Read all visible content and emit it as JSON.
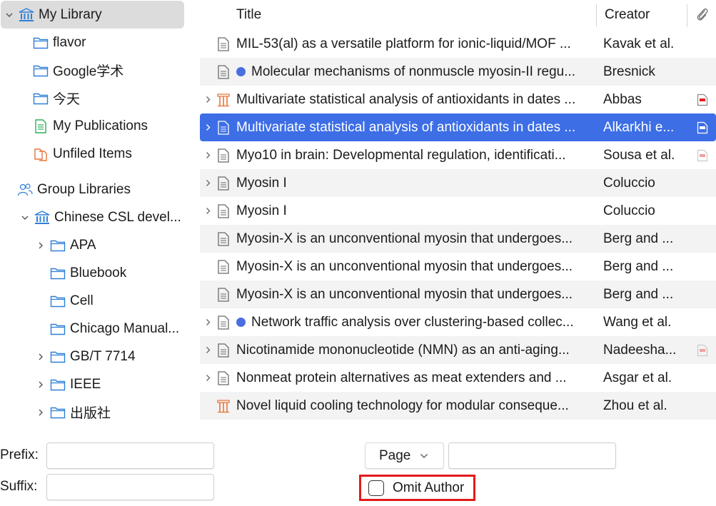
{
  "tree": {
    "my_library": "My Library",
    "collections": [
      {
        "label": "flavor",
        "icon": "folder-icon"
      },
      {
        "label": "Google学术",
        "icon": "folder-icon"
      },
      {
        "label": "今天",
        "icon": "folder-icon"
      },
      {
        "label": "My Publications",
        "icon": "publications-icon"
      },
      {
        "label": "Unfiled Items",
        "icon": "unfiled-icon"
      }
    ],
    "group_libraries": "Group Libraries",
    "group": {
      "label": "Chinese CSL devel...",
      "children": [
        {
          "label": "APA",
          "expandable": true
        },
        {
          "label": "Bluebook",
          "expandable": false
        },
        {
          "label": "Cell",
          "expandable": false
        },
        {
          "label": "Chicago Manual...",
          "expandable": false
        },
        {
          "label": "GB/T 7714",
          "expandable": true
        },
        {
          "label": "IEEE",
          "expandable": true
        },
        {
          "label": "出版社",
          "expandable": true
        }
      ]
    }
  },
  "table": {
    "columns": {
      "title": "Title",
      "creator": "Creator"
    },
    "rows": [
      {
        "title": "MIL-53(al) as a versatile platform for ionic-liquid/MOF ...",
        "creator": "Kavak et al.",
        "type": "document",
        "twisty": false,
        "dot": false,
        "attachment": ""
      },
      {
        "title": "Molecular mechanisms of nonmuscle myosin-II regu...",
        "creator": "Bresnick",
        "type": "document",
        "twisty": false,
        "dot": true,
        "attachment": ""
      },
      {
        "title": "Multivariate statistical analysis of antioxidants in dates ...",
        "creator": "Abbas",
        "type": "book",
        "twisty": true,
        "dot": false,
        "attachment": "pdf"
      },
      {
        "title": "Multivariate statistical analysis of antioxidants in dates ...",
        "creator": "Alkarkhi e...",
        "type": "document",
        "twisty": true,
        "dot": false,
        "attachment": "pdf",
        "selected": true
      },
      {
        "title": "Myo10 in brain: Developmental regulation, identificati...",
        "creator": "Sousa et al.",
        "type": "document",
        "twisty": true,
        "dot": false,
        "attachment": "pdf-faded"
      },
      {
        "title": "Myosin I",
        "creator": "Coluccio",
        "type": "document",
        "twisty": true,
        "dot": false,
        "attachment": ""
      },
      {
        "title": "Myosin I",
        "creator": "Coluccio",
        "type": "document",
        "twisty": true,
        "dot": false,
        "attachment": ""
      },
      {
        "title": "Myosin-X is an unconventional myosin that undergoes...",
        "creator": "Berg and ...",
        "type": "document",
        "twisty": false,
        "dot": false,
        "attachment": ""
      },
      {
        "title": "Myosin-X is an unconventional myosin that undergoes...",
        "creator": "Berg and ...",
        "type": "document",
        "twisty": false,
        "dot": false,
        "attachment": ""
      },
      {
        "title": "Myosin-X is an unconventional myosin that undergoes...",
        "creator": "Berg and ...",
        "type": "document",
        "twisty": false,
        "dot": false,
        "attachment": ""
      },
      {
        "title": "Network traffic analysis over clustering-based collec...",
        "creator": "Wang et al.",
        "type": "document",
        "twisty": true,
        "dot": true,
        "attachment": ""
      },
      {
        "title": "Nicotinamide mononucleotide (NMN) as an anti-aging...",
        "creator": "Nadeesha...",
        "type": "document",
        "twisty": true,
        "dot": false,
        "attachment": "pdf-faded"
      },
      {
        "title": "Nonmeat protein alternatives as meat extenders and ...",
        "creator": "Asgar et al.",
        "type": "document",
        "twisty": true,
        "dot": false,
        "attachment": ""
      },
      {
        "title": "Novel liquid cooling technology for modular conseque...",
        "creator": "Zhou et al.",
        "type": "book",
        "twisty": false,
        "dot": false,
        "attachment": ""
      }
    ]
  },
  "form": {
    "prefix_label": "Prefix:",
    "suffix_label": "Suffix:",
    "prefix_value": "",
    "suffix_value": "",
    "locator_type": "Page",
    "locator_value": "",
    "omit_author_label": "Omit Author",
    "omit_author_checked": false
  },
  "colors": {
    "selection": "#3d6ee6",
    "folder": "#2f7fd8",
    "dot": "#4a6ee0",
    "highlight": "#e31b1b"
  }
}
